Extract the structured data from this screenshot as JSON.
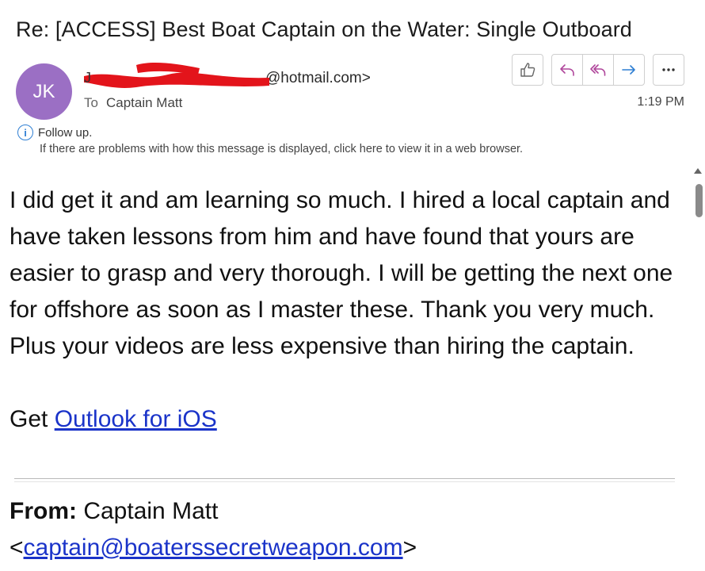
{
  "email": {
    "subject": "Re: [ACCESS] Best Boat Captain on the Water: Single Outboard",
    "avatar_initials": "JK",
    "sender_visible": "@hotmail.com>",
    "to_label": "To",
    "recipient": "Captain  Matt",
    "time": "1:19 PM",
    "followup_text": "Follow up.",
    "web_notice": "If there are problems with how this message is displayed, click here to view it in a web browser."
  },
  "actions": {
    "like_icon": "thumbs-up-icon",
    "reply_icon": "reply-icon",
    "reply_all_icon": "reply-all-icon",
    "forward_icon": "forward-icon",
    "more_icon": "more-icon"
  },
  "body": {
    "paragraph": "I did get it and am learning so much. I hired a local captain and have taken lessons from him and have found that yours are easier to grasp and very thorough. I will be getting the next one for offshore as soon as I master these. Thank you very much. Plus your videos are less expensive than hiring the captain.",
    "get_prefix": "Get ",
    "outlook_link": "Outlook for iOS"
  },
  "quoted": {
    "from_label": "From:",
    "from_name": " Captain Matt",
    "from_email": "captain@boaterssecretweapon.com",
    "lt": "<",
    "gt": ">"
  },
  "colors": {
    "avatar": "#9b6fc4",
    "link": "#1a33c9",
    "accent_blue": "#2f7fd3",
    "reply_purple": "#b0479c",
    "redaction": "#e3141b"
  }
}
